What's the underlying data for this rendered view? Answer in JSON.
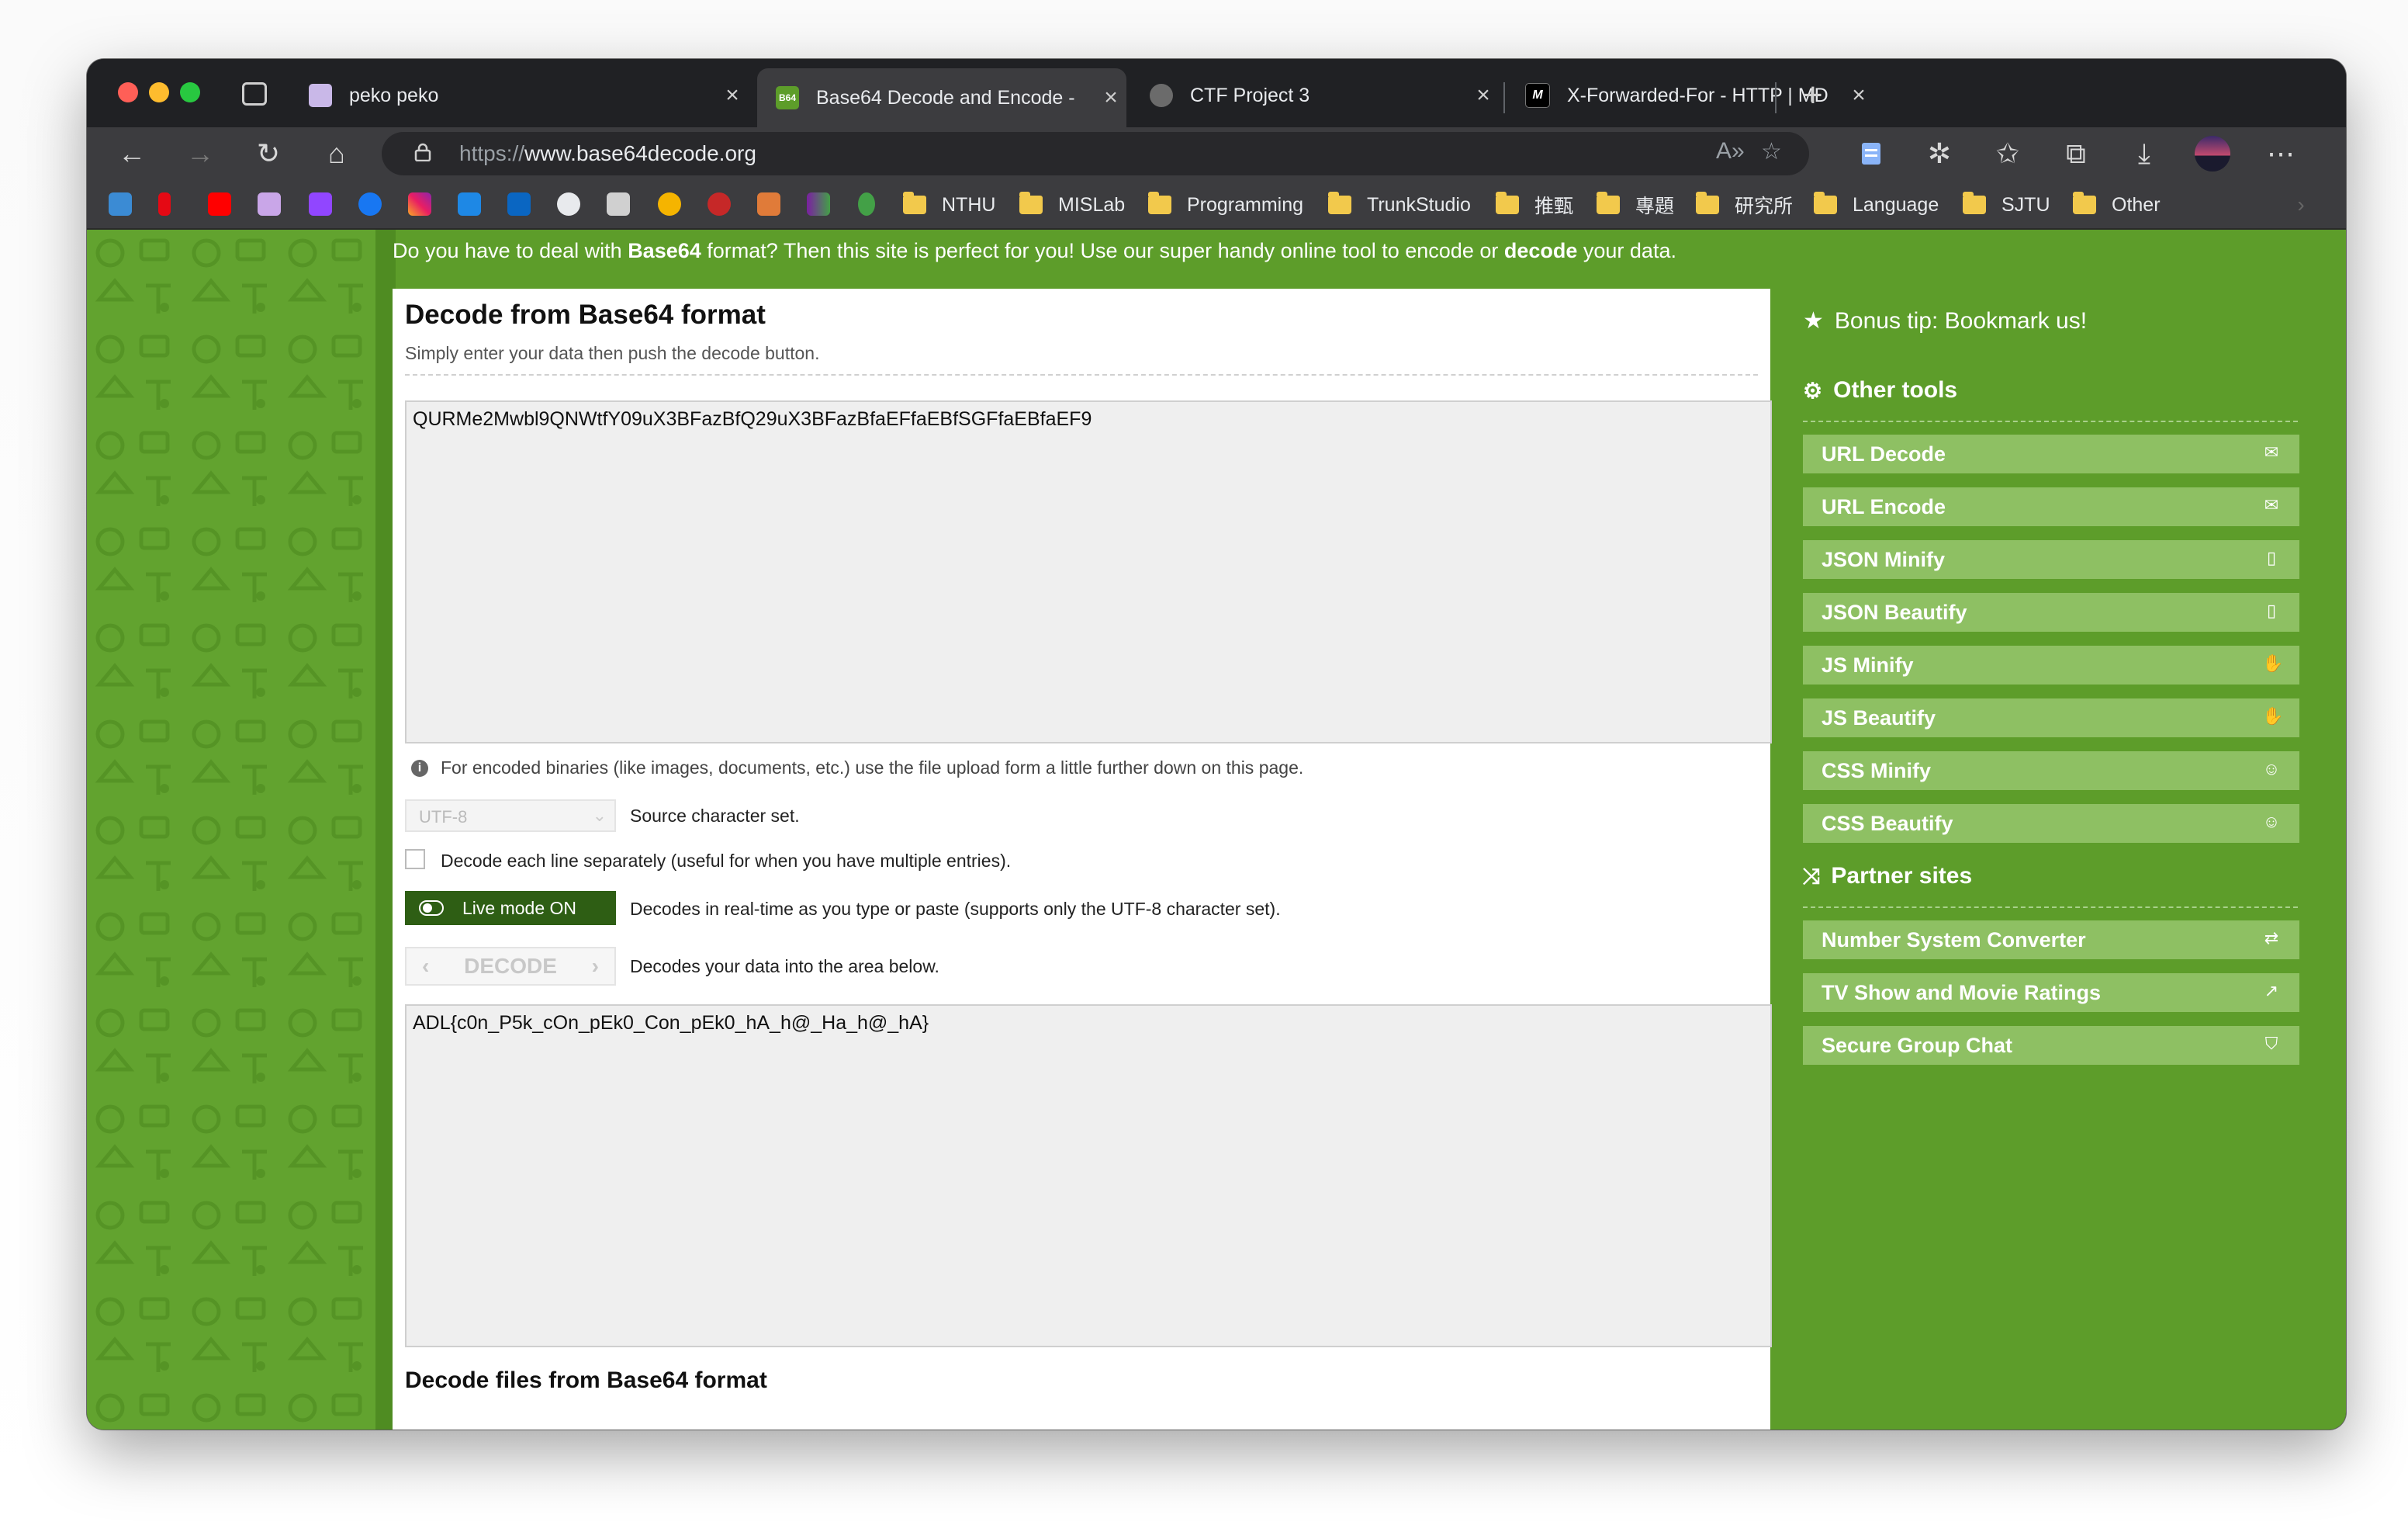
{
  "browser": {
    "tabs": [
      {
        "title": "peko peko",
        "favicon": "peko-icon",
        "active": false
      },
      {
        "title": "Base64 Decode and Encode - ",
        "favicon": "b64-icon",
        "active": true
      },
      {
        "title": "CTF Project 3",
        "favicon": "ctf-icon",
        "active": false
      },
      {
        "title": "X-Forwarded-For - HTTP | MD",
        "favicon": "mdn-icon",
        "active": false
      }
    ],
    "tab_close": "×",
    "new_tab": "+",
    "url_protocol": "https://",
    "url_host": "www.base64decode.org",
    "bookmarks_folders": [
      "NTHU",
      "MISLab",
      "Programming",
      "TrunkStudio",
      "推甄",
      "專題",
      "研究所",
      "Language",
      "SJTU",
      "Other"
    ],
    "b64_favicon_text": "B64"
  },
  "page": {
    "banner": {
      "pre": "Do you have to deal with ",
      "b1": "Base64",
      "mid": " format? Then this site is perfect for you! Use our super handy online tool to encode or ",
      "b2": "decode",
      "post": " your data."
    },
    "title": "Decode from Base64 format",
    "subtitle": "Simply enter your data then push the decode button.",
    "input_value": "QURMe2Mwbl9QNWtfY09uX3BFazBfQ29uX3BFazBfaEFfaEBfSGFfaEBfaEF9",
    "info_text": "For encoded binaries (like images, documents, etc.) use the file upload form a little further down on this page.",
    "charset_value": "UTF-8",
    "charset_label": "Source character set.",
    "each_line_label": "Decode each line separately (useful for when you have multiple entries).",
    "live_mode_label": "Live mode ON",
    "live_mode_desc": "Decodes in real-time as you type or paste (supports only the UTF-8 character set).",
    "decode_button": "DECODE",
    "decode_desc": "Decodes your data into the area below.",
    "output_value": "ADL{c0n_P5k_cOn_pEk0_Con_pEk0_hA_h@_Ha_h@_hA}",
    "files_title": "Decode files from Base64 format"
  },
  "sidebar": {
    "tip": "Bonus tip: Bookmark us!",
    "other_tools_title": "Other tools",
    "tools": [
      {
        "label": "URL Decode",
        "icon": "envelope-open-icon"
      },
      {
        "label": "URL Encode",
        "icon": "envelope-icon"
      },
      {
        "label": "JSON Minify",
        "icon": "file-icon"
      },
      {
        "label": "JSON Beautify",
        "icon": "file-code-icon"
      },
      {
        "label": "JS Minify",
        "icon": "hand-icon"
      },
      {
        "label": "JS Beautify",
        "icon": "hand-paper-icon"
      },
      {
        "label": "CSS Minify",
        "icon": "smile-icon"
      },
      {
        "label": "CSS Beautify",
        "icon": "smile-icon"
      }
    ],
    "partner_title": "Partner sites",
    "partners": [
      {
        "label": "Number System Converter",
        "icon": "exchange-icon"
      },
      {
        "label": "TV Show and Movie Ratings",
        "icon": "chart-line-icon"
      },
      {
        "label": "Secure Group Chat",
        "icon": "shield-icon"
      }
    ]
  },
  "colors": {
    "page_green": "#5d9d2a",
    "tool_green": "#8ec063",
    "live_mode_dark_green": "#2e5e14"
  }
}
